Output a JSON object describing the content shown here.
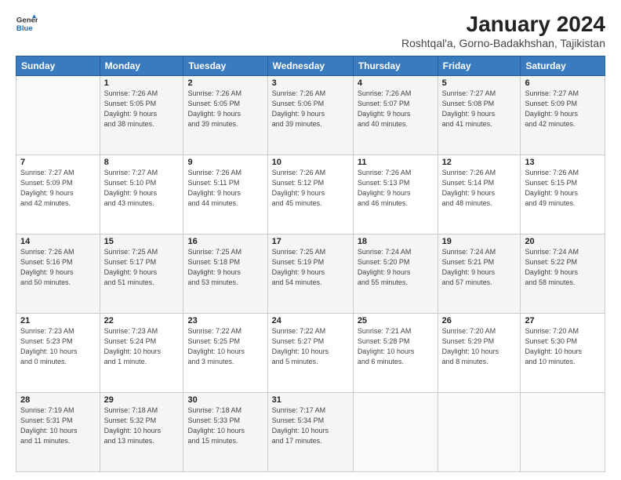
{
  "logo": {
    "line1": "General",
    "line2": "Blue"
  },
  "title": "January 2024",
  "subtitle": "Roshtqal'a, Gorno-Badakhshan, Tajikistan",
  "weekdays": [
    "Sunday",
    "Monday",
    "Tuesday",
    "Wednesday",
    "Thursday",
    "Friday",
    "Saturday"
  ],
  "weeks": [
    [
      {
        "day": "",
        "info": ""
      },
      {
        "day": "1",
        "info": "Sunrise: 7:26 AM\nSunset: 5:05 PM\nDaylight: 9 hours\nand 38 minutes."
      },
      {
        "day": "2",
        "info": "Sunrise: 7:26 AM\nSunset: 5:05 PM\nDaylight: 9 hours\nand 39 minutes."
      },
      {
        "day": "3",
        "info": "Sunrise: 7:26 AM\nSunset: 5:06 PM\nDaylight: 9 hours\nand 39 minutes."
      },
      {
        "day": "4",
        "info": "Sunrise: 7:26 AM\nSunset: 5:07 PM\nDaylight: 9 hours\nand 40 minutes."
      },
      {
        "day": "5",
        "info": "Sunrise: 7:27 AM\nSunset: 5:08 PM\nDaylight: 9 hours\nand 41 minutes."
      },
      {
        "day": "6",
        "info": "Sunrise: 7:27 AM\nSunset: 5:09 PM\nDaylight: 9 hours\nand 42 minutes."
      }
    ],
    [
      {
        "day": "7",
        "info": "Sunrise: 7:27 AM\nSunset: 5:09 PM\nDaylight: 9 hours\nand 42 minutes."
      },
      {
        "day": "8",
        "info": "Sunrise: 7:27 AM\nSunset: 5:10 PM\nDaylight: 9 hours\nand 43 minutes."
      },
      {
        "day": "9",
        "info": "Sunrise: 7:26 AM\nSunset: 5:11 PM\nDaylight: 9 hours\nand 44 minutes."
      },
      {
        "day": "10",
        "info": "Sunrise: 7:26 AM\nSunset: 5:12 PM\nDaylight: 9 hours\nand 45 minutes."
      },
      {
        "day": "11",
        "info": "Sunrise: 7:26 AM\nSunset: 5:13 PM\nDaylight: 9 hours\nand 46 minutes."
      },
      {
        "day": "12",
        "info": "Sunrise: 7:26 AM\nSunset: 5:14 PM\nDaylight: 9 hours\nand 48 minutes."
      },
      {
        "day": "13",
        "info": "Sunrise: 7:26 AM\nSunset: 5:15 PM\nDaylight: 9 hours\nand 49 minutes."
      }
    ],
    [
      {
        "day": "14",
        "info": "Sunrise: 7:26 AM\nSunset: 5:16 PM\nDaylight: 9 hours\nand 50 minutes."
      },
      {
        "day": "15",
        "info": "Sunrise: 7:25 AM\nSunset: 5:17 PM\nDaylight: 9 hours\nand 51 minutes."
      },
      {
        "day": "16",
        "info": "Sunrise: 7:25 AM\nSunset: 5:18 PM\nDaylight: 9 hours\nand 53 minutes."
      },
      {
        "day": "17",
        "info": "Sunrise: 7:25 AM\nSunset: 5:19 PM\nDaylight: 9 hours\nand 54 minutes."
      },
      {
        "day": "18",
        "info": "Sunrise: 7:24 AM\nSunset: 5:20 PM\nDaylight: 9 hours\nand 55 minutes."
      },
      {
        "day": "19",
        "info": "Sunrise: 7:24 AM\nSunset: 5:21 PM\nDaylight: 9 hours\nand 57 minutes."
      },
      {
        "day": "20",
        "info": "Sunrise: 7:24 AM\nSunset: 5:22 PM\nDaylight: 9 hours\nand 58 minutes."
      }
    ],
    [
      {
        "day": "21",
        "info": "Sunrise: 7:23 AM\nSunset: 5:23 PM\nDaylight: 10 hours\nand 0 minutes."
      },
      {
        "day": "22",
        "info": "Sunrise: 7:23 AM\nSunset: 5:24 PM\nDaylight: 10 hours\nand 1 minute."
      },
      {
        "day": "23",
        "info": "Sunrise: 7:22 AM\nSunset: 5:25 PM\nDaylight: 10 hours\nand 3 minutes."
      },
      {
        "day": "24",
        "info": "Sunrise: 7:22 AM\nSunset: 5:27 PM\nDaylight: 10 hours\nand 5 minutes."
      },
      {
        "day": "25",
        "info": "Sunrise: 7:21 AM\nSunset: 5:28 PM\nDaylight: 10 hours\nand 6 minutes."
      },
      {
        "day": "26",
        "info": "Sunrise: 7:20 AM\nSunset: 5:29 PM\nDaylight: 10 hours\nand 8 minutes."
      },
      {
        "day": "27",
        "info": "Sunrise: 7:20 AM\nSunset: 5:30 PM\nDaylight: 10 hours\nand 10 minutes."
      }
    ],
    [
      {
        "day": "28",
        "info": "Sunrise: 7:19 AM\nSunset: 5:31 PM\nDaylight: 10 hours\nand 11 minutes."
      },
      {
        "day": "29",
        "info": "Sunrise: 7:18 AM\nSunset: 5:32 PM\nDaylight: 10 hours\nand 13 minutes."
      },
      {
        "day": "30",
        "info": "Sunrise: 7:18 AM\nSunset: 5:33 PM\nDaylight: 10 hours\nand 15 minutes."
      },
      {
        "day": "31",
        "info": "Sunrise: 7:17 AM\nSunset: 5:34 PM\nDaylight: 10 hours\nand 17 minutes."
      },
      {
        "day": "",
        "info": ""
      },
      {
        "day": "",
        "info": ""
      },
      {
        "day": "",
        "info": ""
      }
    ]
  ]
}
